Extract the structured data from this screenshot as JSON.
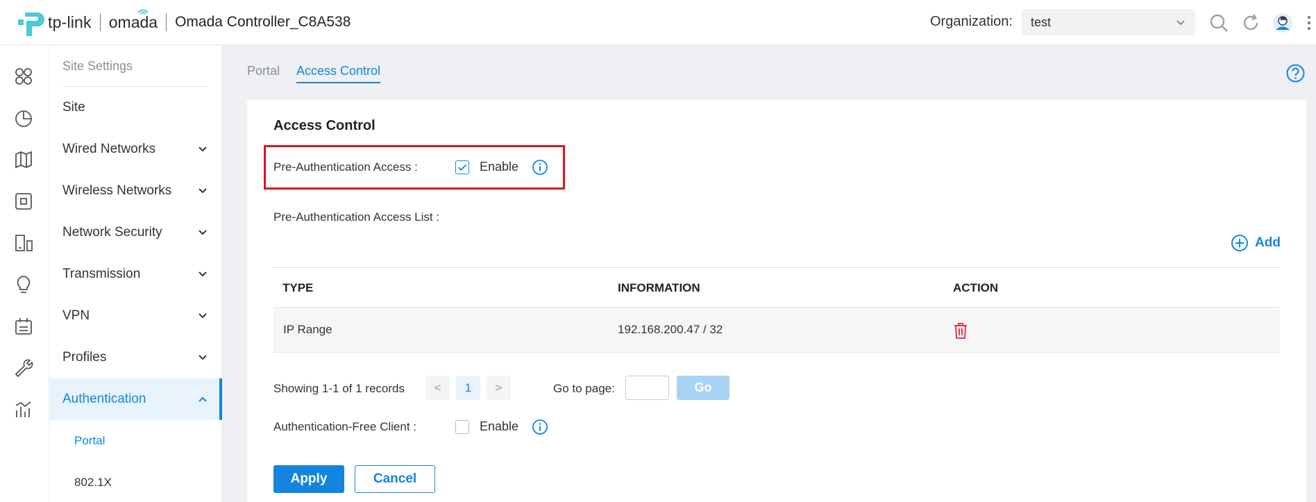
{
  "header": {
    "brand": "tp-link",
    "product": "omada",
    "controller_name": "Omada Controller_C8A538",
    "org_label": "Organization:",
    "org_value": "test"
  },
  "rail": {
    "icons": [
      "dashboard-icon",
      "statistics-icon",
      "map-icon",
      "devices-icon",
      "clients-icon",
      "insight-icon",
      "logs-icon",
      "tools-icon",
      "reports-icon"
    ]
  },
  "sidebar": {
    "title": "Site Settings",
    "items": [
      {
        "label": "Site"
      },
      {
        "label": "Wired Networks"
      },
      {
        "label": "Wireless Networks"
      },
      {
        "label": "Network Security"
      },
      {
        "label": "Transmission"
      },
      {
        "label": "VPN"
      },
      {
        "label": "Profiles"
      },
      {
        "label": "Authentication"
      }
    ],
    "sub_items": [
      {
        "label": "Portal"
      },
      {
        "label": "802.1X"
      }
    ]
  },
  "tabs": [
    {
      "label": "Portal"
    },
    {
      "label": "Access Control"
    }
  ],
  "panel": {
    "title": "Access Control",
    "pre_auth_label": "Pre-Authentication Access :",
    "pre_auth_enable": "Enable",
    "pre_auth_checked": true,
    "pre_auth_list_label": "Pre-Authentication Access List :",
    "add_label": "Add",
    "table": {
      "columns": [
        "TYPE",
        "INFORMATION",
        "ACTION"
      ],
      "rows": [
        {
          "type": "IP Range",
          "information": "192.168.200.47 / 32"
        }
      ]
    },
    "pager": {
      "showing": "Showing 1-1 of 1 records",
      "current_page": "1",
      "prev": "<",
      "next": ">",
      "goto_label": "Go to page:",
      "go_label": "Go"
    },
    "free_client_label": "Authentication-Free Client :",
    "free_client_enable": "Enable",
    "free_client_checked": false,
    "apply_label": "Apply",
    "cancel_label": "Cancel"
  },
  "colors": {
    "accent": "#1384e0",
    "highlight_border": "#e0121e",
    "delete": "#e8364a"
  }
}
